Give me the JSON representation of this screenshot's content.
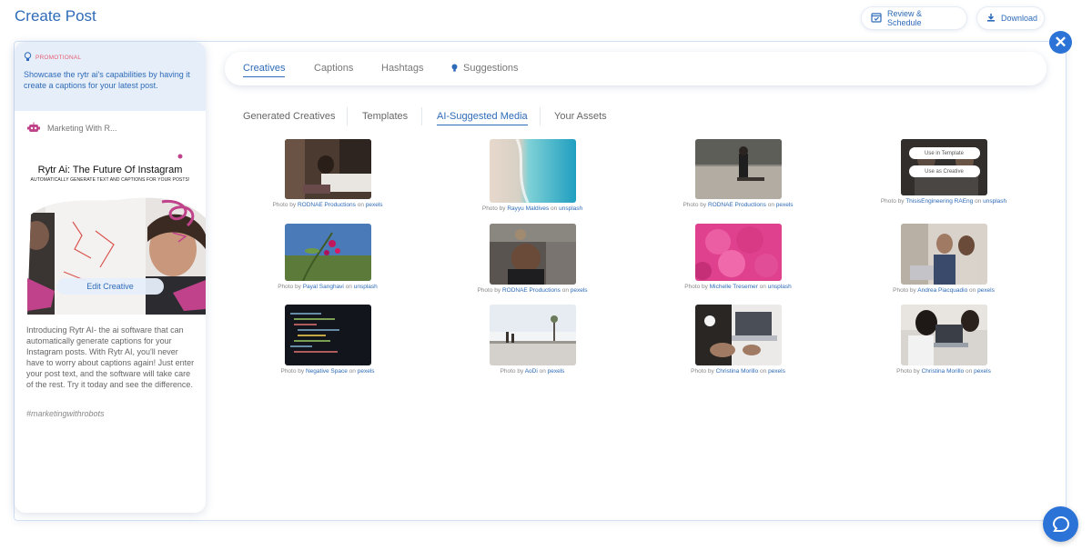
{
  "header": {
    "title": "Create Post",
    "review_label": "Review & Schedule",
    "download_label": "Download"
  },
  "preview": {
    "promo_tag": "PROMOTIONAL",
    "promo_text": "Showcase the rytr ai's capabilities by having it create a captions for your latest post.",
    "account_name": "Marketing With R...",
    "creative_title": "Rytr Ai: The Future Of Instagram",
    "creative_subtitle": "AUTOMATICALLY GENERATE TEXT AND CAPTIONS FOR YOUR POSTS!",
    "edit_label": "Edit Creative",
    "caption": "Introducing Rytr AI- the ai software that can automatically generate captions for your Instagram posts. With Rytr AI, you'll never have to worry about captions again! Just enter your post text, and the software will take care of the rest. Try it today and see the difference.",
    "hashtag": "#marketingwithrobots"
  },
  "tabs": {
    "creatives": "Creatives",
    "captions": "Captions",
    "hashtags": "Hashtags",
    "suggestions": "Suggestions"
  },
  "subtabs": {
    "generated": "Generated Creatives",
    "templates": "Templates",
    "ai_media": "AI-Suggested Media",
    "assets": "Your Assets"
  },
  "overlay": {
    "use_template": "Use in Template",
    "use_creative": "Use as Creative"
  },
  "media": [
    {
      "prefix": "Photo by",
      "author": "RODNAE Productions",
      "on": "on",
      "source": "pexels"
    },
    {
      "prefix": "Photo by",
      "author": "Rayyu Maldives",
      "on": "on",
      "source": "unsplash"
    },
    {
      "prefix": "Photo by",
      "author": "RODNAE Productions",
      "on": "on",
      "source": "pexels"
    },
    {
      "prefix": "Photo by",
      "author": "ThisisEngineering RAEng",
      "on": "on",
      "source": "unsplash"
    },
    {
      "prefix": "Photo by",
      "author": "Payal Sanghavi",
      "on": "on",
      "source": "unsplash"
    },
    {
      "prefix": "Photo by",
      "author": "RODNAE Productions",
      "on": "on",
      "source": "pexels"
    },
    {
      "prefix": "Photo by",
      "author": "Michelle Tresemer",
      "on": "on",
      "source": "unsplash"
    },
    {
      "prefix": "Photo by",
      "author": "Andrea Piacquadio",
      "on": "on",
      "source": "pexels"
    },
    {
      "prefix": "Photo by",
      "author": "Negative Space",
      "on": "on",
      "source": "pexels"
    },
    {
      "prefix": "Photo by",
      "author": "AoDi",
      "on": "on",
      "source": "pexels"
    },
    {
      "prefix": "Photo by",
      "author": "Christina Morillo",
      "on": "on",
      "source": "pexels"
    },
    {
      "prefix": "Photo by",
      "author": "Christina Morillo",
      "on": "on",
      "source": "pexels"
    }
  ],
  "colors": {
    "accent": "#2e6bb8",
    "primary_button": "#2b73d6",
    "promo_tag": "#e55f73",
    "promo_bg": "#e6eefa"
  }
}
